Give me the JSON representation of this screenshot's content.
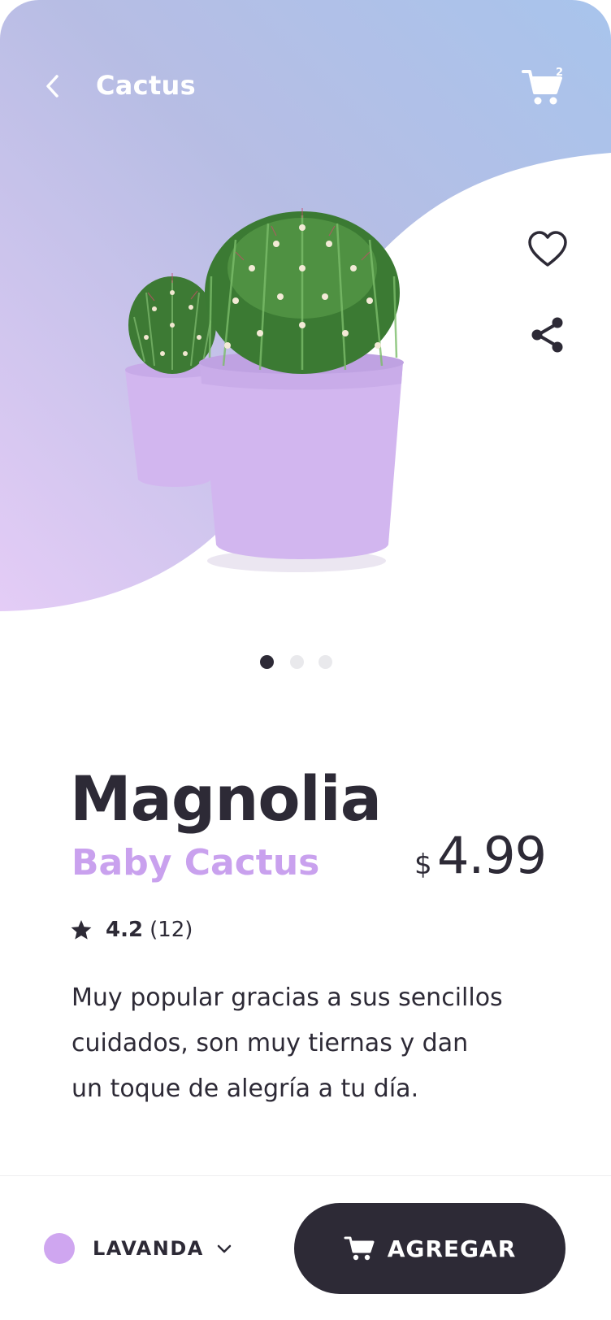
{
  "header": {
    "title": "Cactus",
    "cart_count": "2"
  },
  "icons": {
    "back": "chevron-left-icon",
    "cart": "cart-icon",
    "favorite": "heart-icon",
    "share": "share-icon",
    "rating": "star-icon",
    "dropdown": "chevron-down-icon"
  },
  "carousel": {
    "total": 3,
    "active_index": 0
  },
  "product": {
    "name": "Magnolia",
    "subtitle": "Baby Cactus",
    "currency": "$",
    "price": "4.99",
    "rating": "4.2",
    "reviews": "(12)",
    "description_lines": [
      "Muy popular gracias a sus sencillos",
      "cuidados, son muy tiernas y dan",
      "un toque de alegría a tu día."
    ]
  },
  "footer": {
    "color_label": "LAVANDA",
    "add_label": "AGREGAR"
  },
  "colors": {
    "gradient_top_left": "#b7bde4",
    "gradient_top_right": "#a8c4ec",
    "gradient_bottom": "#e4ccf6",
    "accent_purple": "#c9a1ee",
    "swatch": "#cfa6f0",
    "dark": "#2d2a36",
    "pot": "#d2b6ef"
  }
}
